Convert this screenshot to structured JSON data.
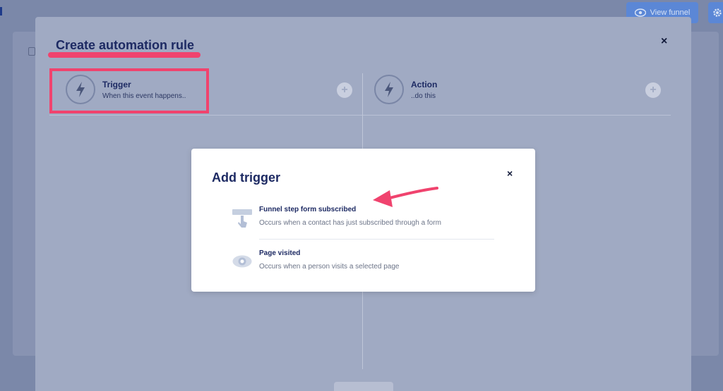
{
  "background": {
    "view_funnel_label": "View funnel"
  },
  "modal": {
    "title": "Create automation rule",
    "close": "×",
    "trigger": {
      "name": "Trigger",
      "description": "When this event happens.."
    },
    "action": {
      "name": "Action",
      "description": "..do this"
    },
    "add_symbol": "+"
  },
  "dialog": {
    "title": "Add trigger",
    "close": "×",
    "options": [
      {
        "name": "Funnel step form subscribed",
        "description": "Occurs when a contact has just subscribed through a form",
        "icon": "form-subscribe-icon"
      },
      {
        "name": "Page visited",
        "description": "Occurs when a person visits a selected page",
        "icon": "eye-icon"
      }
    ]
  },
  "colors": {
    "accent": "#f0436e",
    "navy": "#1d2a63",
    "button_blue": "#5b87d6"
  }
}
